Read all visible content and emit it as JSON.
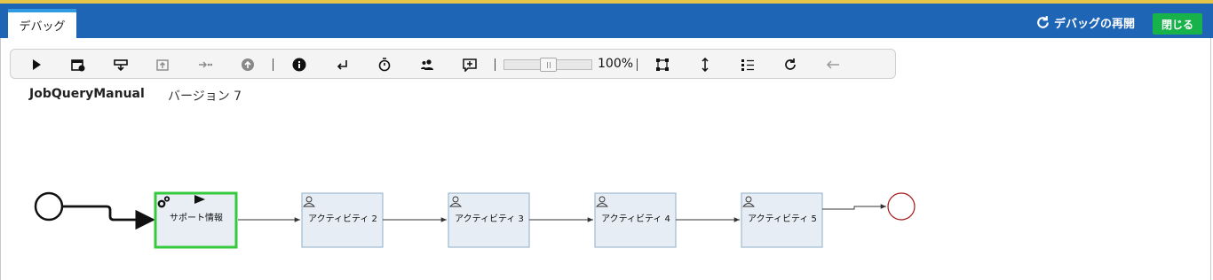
{
  "header": {
    "tab_label": "デバッグ",
    "restart_label": "デバッグの再開",
    "close_label": "閉じる",
    "header_color": "#1f65b6",
    "close_color": "#17b24a"
  },
  "toolbar": {
    "icons": [
      "play-icon",
      "calendar-clock-icon",
      "step-over-icon",
      "step-into-icon",
      "step-forward-icon",
      "step-out-icon",
      "info-icon",
      "return-icon",
      "timer-icon",
      "users-icon",
      "comment-add-icon",
      "fit-icon",
      "expand-vertical-icon",
      "list-icon",
      "refresh-icon",
      "back-arrow-icon"
    ],
    "zoom": "100%",
    "zoom_level": 1.0
  },
  "process": {
    "name": "JobQueryManual",
    "version": "バージョン 7"
  },
  "diagram": {
    "tasks": [
      {
        "label": "サポート情報",
        "type": "service",
        "state": "active",
        "color": "#35c93e"
      },
      {
        "label": "アクティビティ 2",
        "type": "user"
      },
      {
        "label": "アクティビティ 3",
        "type": "user"
      },
      {
        "label": "アクティビティ 4",
        "type": "user"
      },
      {
        "label": "アクティビティ 5",
        "type": "user"
      }
    ],
    "end_event_color": "#a01818"
  }
}
